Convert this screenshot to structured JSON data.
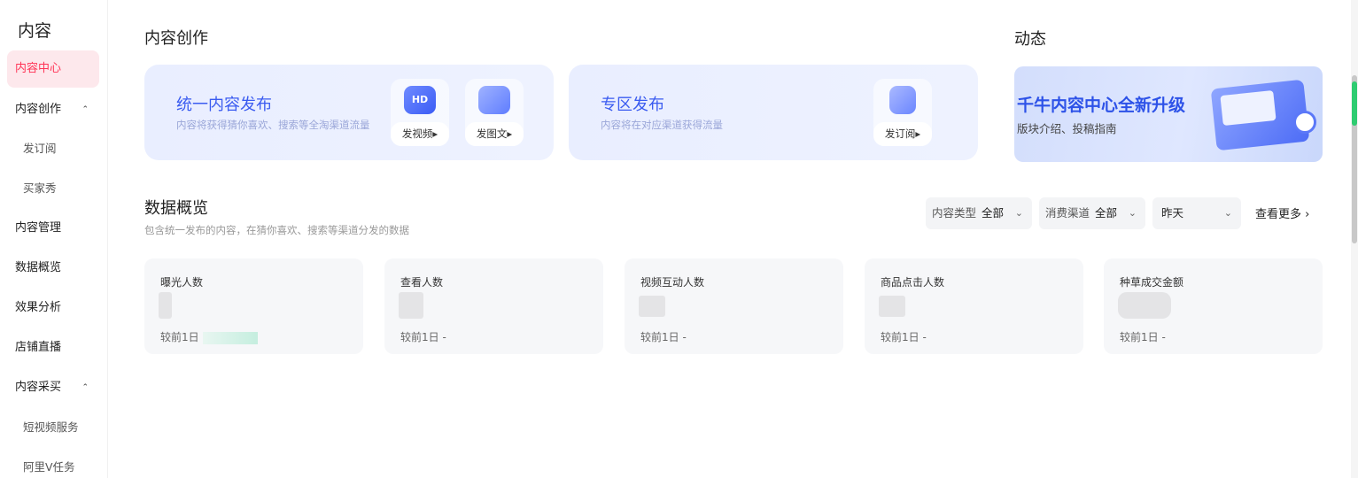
{
  "sidebar": {
    "title": "内容",
    "items": [
      {
        "label": "内容中心",
        "active": true
      },
      {
        "label": "内容创作",
        "expandable": true
      },
      {
        "label": "发订阅",
        "sub": true
      },
      {
        "label": "买家秀",
        "sub": true
      },
      {
        "label": "内容管理"
      },
      {
        "label": "数据概览"
      },
      {
        "label": "效果分析"
      },
      {
        "label": "店铺直播"
      },
      {
        "label": "内容采买",
        "expandable": true
      },
      {
        "label": "短视频服务",
        "sub": true
      },
      {
        "label": "阿里V任务",
        "sub": true
      }
    ],
    "caret": "⌃"
  },
  "creation": {
    "title": "内容创作",
    "unified": {
      "title": "统一内容发布",
      "desc": "内容将获得猜你喜欢、搜索等全淘渠道流量",
      "video_icon": "HD",
      "video_btn": "发视频▸",
      "image_btn": "发图文▸"
    },
    "zone": {
      "title": "专区发布",
      "desc": "内容将在对应渠道获得流量",
      "subscribe_btn": "发订阅▸"
    }
  },
  "dynamic": {
    "title": "动态",
    "banner_title": "千牛内容中心全新升级",
    "banner_sub": "版块介绍、投稿指南"
  },
  "overview": {
    "title": "数据概览",
    "desc": "包含统一发布的内容，在猜你喜欢、搜索等渠道分发的数据",
    "filters": {
      "content_type_label": "内容类型",
      "content_type_value": "全部",
      "channel_label": "消费渠道",
      "channel_value": "全部",
      "date_value": "昨天",
      "caret": "⌄"
    },
    "more": "查看更多 ›",
    "metrics": [
      {
        "label": "曝光人数",
        "compare": "较前1日"
      },
      {
        "label": "查看人数",
        "compare": "较前1日 -"
      },
      {
        "label": "视频互动人数",
        "compare": "较前1日 -"
      },
      {
        "label": "商品点击人数",
        "compare": "较前1日 -"
      },
      {
        "label": "种草成交金额",
        "compare": "较前1日 -"
      }
    ]
  }
}
